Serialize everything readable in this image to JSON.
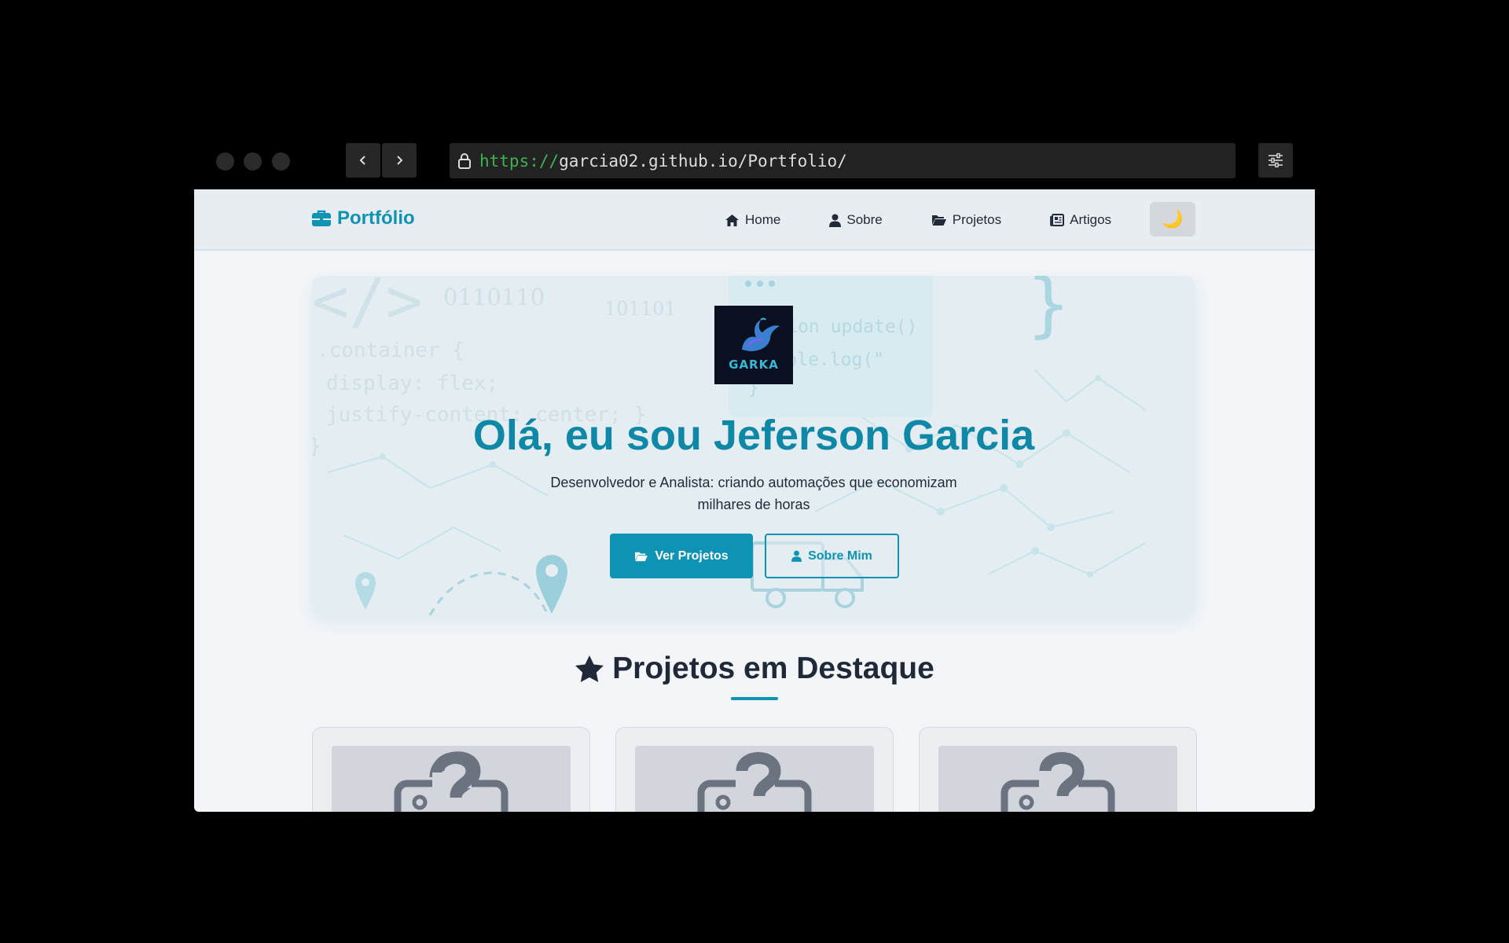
{
  "browser": {
    "url_scheme": "https://",
    "url_rest": "garcia02.github.io/Portfolio/"
  },
  "navbar": {
    "brand": "Portfólio",
    "links": [
      {
        "label": "Home",
        "icon": "home-icon"
      },
      {
        "label": "Sobre",
        "icon": "user-icon"
      },
      {
        "label": "Projetos",
        "icon": "folder-open-icon"
      },
      {
        "label": "Artigos",
        "icon": "newspaper-icon"
      }
    ],
    "theme_toggle": "🌙"
  },
  "hero": {
    "avatar_text": "GARKA",
    "title": "Olá, eu sou Jeferson Garcia",
    "subtitle": "Desenvolvedor e Analista: criando automações que economizam milhares de horas",
    "primary_button": "Ver Projetos",
    "secondary_button": "Sobre Mim",
    "bg_code": {
      "tag": "</>",
      "binary_1": "0110110",
      "binary_2": "101101",
      "css_line_1": ".container {",
      "css_line_2": "display: flex;",
      "css_line_3": "justify-content: center; }",
      "css_line_4": "}",
      "js_line_1": "function update()",
      "js_line_2": "console.log(\"",
      "js_line_3": "}",
      "brace": "}"
    }
  },
  "featured": {
    "title": "Projetos em Destaque"
  },
  "colors": {
    "accent": "#0e93b4",
    "title": "#0f88a8",
    "page_bg": "#f3f5f8",
    "navbar_bg": "#e8edf1"
  }
}
